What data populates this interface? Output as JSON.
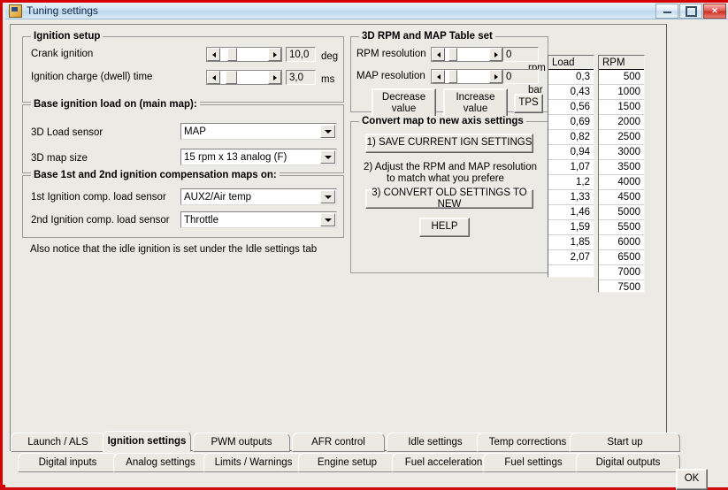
{
  "window": {
    "title": "Tuning settings",
    "icon": "app-icon",
    "minimize_label": "Minimize",
    "maximize_label": "Maximize",
    "close_label": "✕"
  },
  "ignition_setup": {
    "group_title": "Ignition setup",
    "rows": [
      {
        "label": "Crank ignition",
        "value": "10,0",
        "unit": "deg"
      },
      {
        "label": "Ignition charge (dwell) time",
        "value": "3,0",
        "unit": "ms"
      }
    ]
  },
  "base_ignition_load": {
    "group_title": "Base ignition load on (main map):",
    "rows": [
      {
        "label": "3D Load sensor",
        "value": "MAP"
      },
      {
        "label": "3D map size",
        "value": "15 rpm x 13 analog (F)"
      }
    ]
  },
  "compensation_maps": {
    "group_title": "Base 1st and 2nd ignition compensation maps on:",
    "rows": [
      {
        "label": "1st Ignition comp. load sensor",
        "value": "AUX2/Air temp"
      },
      {
        "label": "2nd Ignition comp. load sensor",
        "value": "Throttle"
      }
    ]
  },
  "note": "Also notice that the idle ignition is set under the Idle settings tab",
  "table_set": {
    "group_title": "3D RPM and MAP Table set",
    "rows": [
      {
        "label": "RPM resolution",
        "value": "0",
        "unit": "rpm"
      },
      {
        "label": "MAP resolution",
        "value": "0",
        "unit": "bar"
      }
    ],
    "decrease_button": "Decrease\nvalue",
    "decrease_line1": "Decrease",
    "decrease_line2": "value",
    "increase_line1": "Increase",
    "increase_line2": "value",
    "tps_button": "TPS"
  },
  "convert_map": {
    "group_title": "Convert map to new axis settings",
    "save_button": "1) SAVE CURRENT IGN SETTINGS",
    "step2_line1": "2) Adjust the RPM and MAP resolution",
    "step2_line2": "to match what you prefere",
    "convert_button": "3) CONVERT OLD SETTINGS TO NEW",
    "help_button": "HELP"
  },
  "load_table": {
    "header": "Load",
    "values": [
      "0,3",
      "0,43",
      "0,56",
      "0,69",
      "0,82",
      "0,94",
      "1,07",
      "1,2",
      "1,33",
      "1,46",
      "1,59",
      "1,85",
      "2,07"
    ]
  },
  "rpm_table": {
    "header": "RPM",
    "values": [
      "500",
      "1000",
      "1500",
      "2000",
      "2500",
      "3000",
      "3500",
      "4000",
      "4500",
      "5000",
      "5500",
      "6000",
      "6500",
      "7000",
      "7500"
    ]
  },
  "tabs_row1": [
    {
      "label": "Launch / ALS",
      "active": false
    },
    {
      "label": "Ignition settings",
      "active": true
    },
    {
      "label": "PWM outputs",
      "active": false
    },
    {
      "label": "AFR control",
      "active": false
    },
    {
      "label": "Idle settings",
      "active": false
    },
    {
      "label": "Temp corrections",
      "active": false
    },
    {
      "label": "Start up",
      "active": false
    }
  ],
  "tabs_row2": [
    {
      "label": "Digital inputs",
      "active": false
    },
    {
      "label": "Analog settings",
      "active": false
    },
    {
      "label": "Limits / Warnings",
      "active": false
    },
    {
      "label": "Engine setup",
      "active": false
    },
    {
      "label": "Fuel acceleration",
      "active": false
    },
    {
      "label": "Fuel settings",
      "active": false
    },
    {
      "label": "Digital outputs",
      "active": false
    }
  ],
  "ok_button": "OK"
}
